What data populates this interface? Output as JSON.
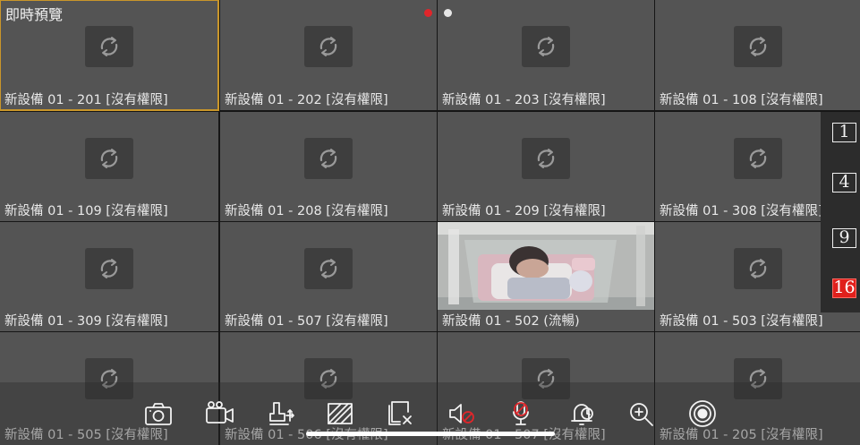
{
  "header": {
    "title": "即時預覽"
  },
  "page_indicator": [
    {
      "color": "#e0262b",
      "active": true
    },
    {
      "color": "#e6e6e6",
      "active": false
    }
  ],
  "cells": [
    {
      "label": "新設備 01 - 201 [沒有權限]",
      "selected": true,
      "live": false
    },
    {
      "label": "新設備 01 - 202 [沒有權限]",
      "live": false
    },
    {
      "label": "新設備 01 - 203 [沒有權限]",
      "live": false
    },
    {
      "label": "新設備 01 - 108 [沒有權限]",
      "live": false
    },
    {
      "label": "新設備 01 - 109 [沒有權限]",
      "live": false
    },
    {
      "label": "新設備 01 - 208 [沒有權限]",
      "live": false
    },
    {
      "label": "新設備 01 - 209 [沒有權限]",
      "live": false
    },
    {
      "label": "新設備 01 - 308 [沒有權限]",
      "live": false
    },
    {
      "label": "新設備 01 - 309 [沒有權限]",
      "live": false
    },
    {
      "label": "新設備 01 - 507 [沒有權限]",
      "live": false
    },
    {
      "label": "新設備 01 - 502 (流暢)",
      "live": true
    },
    {
      "label": "新設備 01 - 503 [沒有權限]",
      "live": false
    },
    {
      "label": "新設備 01 - 505 [沒有權限]",
      "live": false
    },
    {
      "label": "新設備 01 - 506 [沒有權限]",
      "live": false
    },
    {
      "label": "新設備 01 - 507 [沒有權限]",
      "live": false
    },
    {
      "label": "新設備 01 - 205 [沒有權限]",
      "live": false
    }
  ],
  "layout_options": [
    {
      "label": "1",
      "active": false
    },
    {
      "label": "4",
      "active": false
    },
    {
      "label": "9",
      "active": false
    },
    {
      "label": "16",
      "active": true
    }
  ],
  "toolbar": [
    {
      "name": "snapshot-icon"
    },
    {
      "name": "record-icon"
    },
    {
      "name": "ptz-icon"
    },
    {
      "name": "image-adjust-icon"
    },
    {
      "name": "close-window-icon"
    },
    {
      "name": "audio-off-icon"
    },
    {
      "name": "talk-off-icon"
    },
    {
      "name": "alarm-icon"
    },
    {
      "name": "zoom-in-icon"
    },
    {
      "name": "manual-record-icon"
    }
  ],
  "colors": {
    "accent_selected": "#c9962a",
    "layout_active": "#e0201c",
    "cell_bg": "#545454"
  }
}
